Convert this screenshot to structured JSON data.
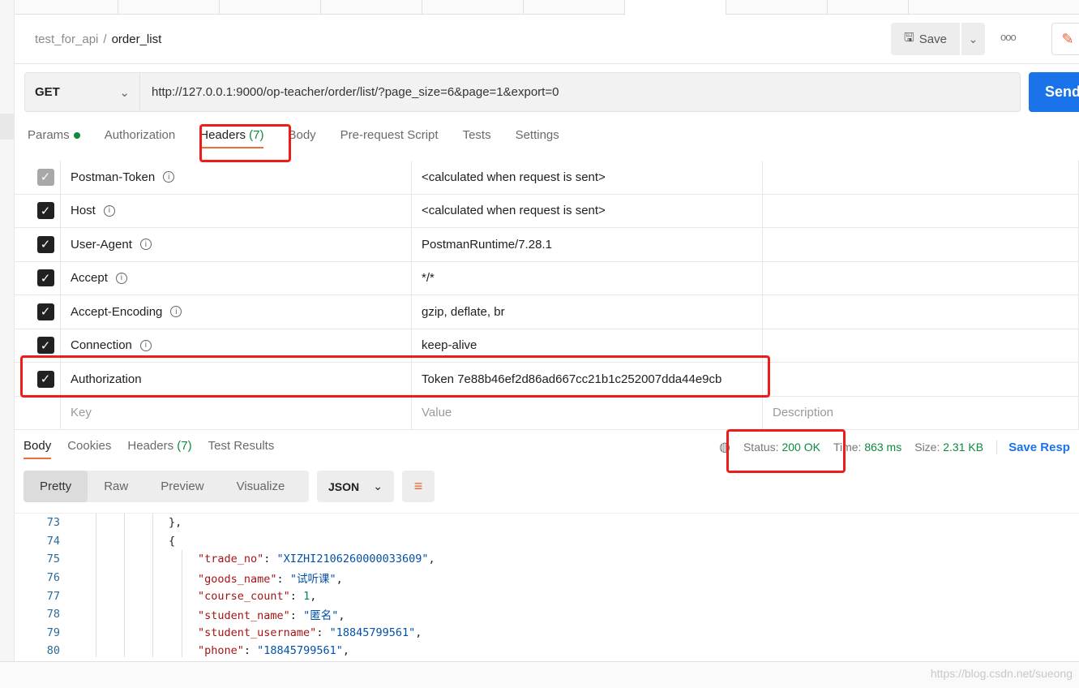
{
  "breadcrumb": {
    "collection": "test_for_api",
    "separator": "/",
    "request": "order_list"
  },
  "toolbar": {
    "save_label": "Save",
    "more_label": "ooo"
  },
  "request": {
    "method": "GET",
    "url": "http://127.0.0.1:9000/op-teacher/order/list/?page_size=6&page=1&export=0",
    "send_label": "Send"
  },
  "req_tabs": {
    "params": "Params",
    "authorization": "Authorization",
    "headers": "Headers",
    "headers_count": "(7)",
    "body": "Body",
    "prerequest": "Pre-request Script",
    "tests": "Tests",
    "settings": "Settings"
  },
  "headers": [
    {
      "key": "Postman-Token",
      "value": "<calculated when request is sent>",
      "checked": true,
      "disabled": true
    },
    {
      "key": "Host",
      "value": "<calculated when request is sent>",
      "checked": true
    },
    {
      "key": "User-Agent",
      "value": "PostmanRuntime/7.28.1",
      "checked": true
    },
    {
      "key": "Accept",
      "value": "*/*",
      "checked": true
    },
    {
      "key": "Accept-Encoding",
      "value": "gzip, deflate, br",
      "checked": true
    },
    {
      "key": "Connection",
      "value": "keep-alive",
      "checked": true
    },
    {
      "key": "Authorization",
      "value": "Token 7e88b46ef2d86ad667cc21b1c252007dda44e9cb",
      "checked": true
    }
  ],
  "headers_placeholder": {
    "key": "Key",
    "value": "Value",
    "description": "Description"
  },
  "resp_tabs": {
    "body": "Body",
    "cookies": "Cookies",
    "headers": "Headers",
    "headers_count": "(7)",
    "test_results": "Test Results"
  },
  "resp_meta": {
    "status_label": "Status:",
    "status": "200 OK",
    "time_label": "Time:",
    "time": "863 ms",
    "size_label": "Size:",
    "size": "2.31 KB",
    "save_response": "Save Resp"
  },
  "format_tabs": {
    "pretty": "Pretty",
    "raw": "Raw",
    "preview": "Preview",
    "visualize": "Visualize",
    "lang": "JSON"
  },
  "code": [
    {
      "ln": "73",
      "text": "},"
    },
    {
      "ln": "74",
      "text": "{"
    },
    {
      "ln": "75",
      "key": "\"trade_no\"",
      "val": "\"XIZHI2106260000033609\""
    },
    {
      "ln": "76",
      "key": "\"goods_name\"",
      "val": "\"试听课\""
    },
    {
      "ln": "77",
      "key": "\"course_count\"",
      "num": "1"
    },
    {
      "ln": "78",
      "key": "\"student_name\"",
      "val": "\"匿名\""
    },
    {
      "ln": "79",
      "key": "\"student_username\"",
      "val": "\"18845799561\""
    },
    {
      "ln": "80",
      "key": "\"phone\"",
      "val": "\"18845799561\""
    }
  ],
  "watermark": "https://blog.csdn.net/sueong",
  "colors": {
    "accent": "#f26b3a",
    "send": "#1a73e8",
    "success": "#0c8a3e",
    "highlight": "#f01c1c"
  }
}
